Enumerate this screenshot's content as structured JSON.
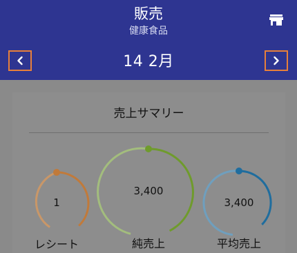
{
  "header": {
    "title": "販売",
    "subtitle": "健康食品",
    "store_icon": "store-icon",
    "date": "14 2月",
    "prev_icon": "chevron-left-icon",
    "next_icon": "chevron-right-icon",
    "background": "#2e3591",
    "nav_border_color": "#e8803a"
  },
  "summary": {
    "title": "売上サマリー",
    "gauges": [
      {
        "value": "1",
        "label": "レシート",
        "color": "#c17a3a"
      },
      {
        "value": "3,400",
        "label": "純売上",
        "color": "#6f9b2c"
      },
      {
        "value": "3,400",
        "label": "平均売上",
        "color": "#1f6d9e"
      }
    ]
  }
}
